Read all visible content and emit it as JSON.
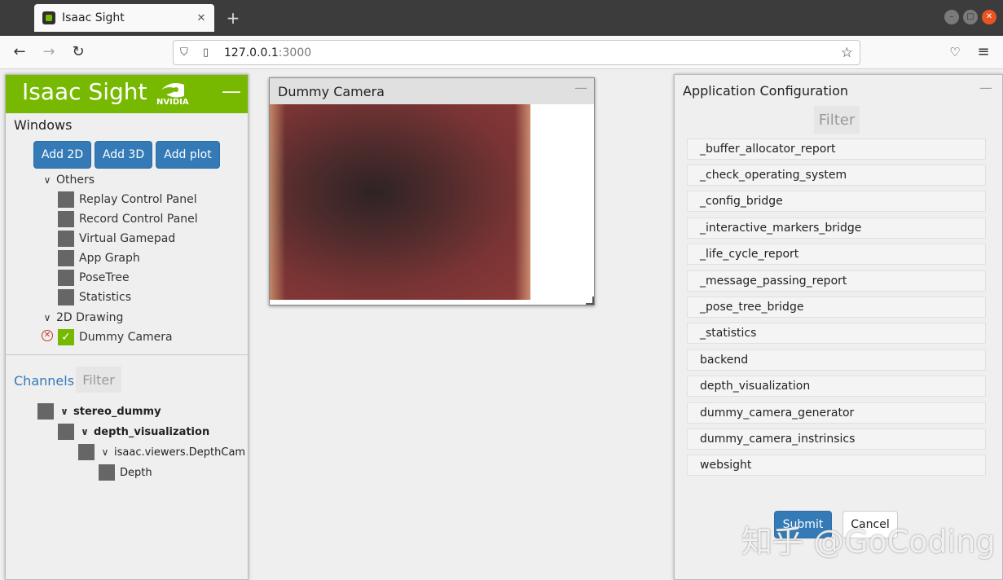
{
  "browser": {
    "tab_title": "Isaac Sight",
    "url_host": "127.0.0.1",
    "url_port": ":3000"
  },
  "left_panel": {
    "brand": "Isaac Sight",
    "brand_logo_text": "NVIDIA",
    "windows_title": "Windows",
    "buttons": [
      "Add 2D",
      "Add 3D",
      "Add plot"
    ],
    "groups": [
      {
        "label": "Others",
        "items": [
          "Replay Control Panel",
          "Record Control Panel",
          "Virtual Gamepad",
          "App Graph",
          "PoseTree",
          "Statistics"
        ]
      },
      {
        "label": "2D Drawing",
        "items": [
          "Dummy Camera"
        ]
      }
    ],
    "channels_title": "Channels",
    "channels_filter_placeholder": "Filter",
    "channel_tree": [
      "stereo_dummy",
      "depth_visualization",
      "isaac.viewers.DepthCamera",
      "Depth"
    ]
  },
  "camera_window": {
    "title": "Dummy Camera"
  },
  "right_panel": {
    "title": "Application Configuration",
    "filter_placeholder": "Filter",
    "items": [
      "_buffer_allocator_report",
      "_check_operating_system",
      "_config_bridge",
      "_interactive_markers_bridge",
      "_life_cycle_report",
      "_message_passing_report",
      "_pose_tree_bridge",
      "_statistics",
      "backend",
      "depth_visualization",
      "dummy_camera_generator",
      "dummy_camera_instrinsics",
      "websight"
    ],
    "submit_label": "Submit",
    "cancel_label": "Cancel"
  },
  "watermark": "知乎 @GoCoding",
  "colors": {
    "brand": "#76b900",
    "primary": "#337ab7"
  }
}
